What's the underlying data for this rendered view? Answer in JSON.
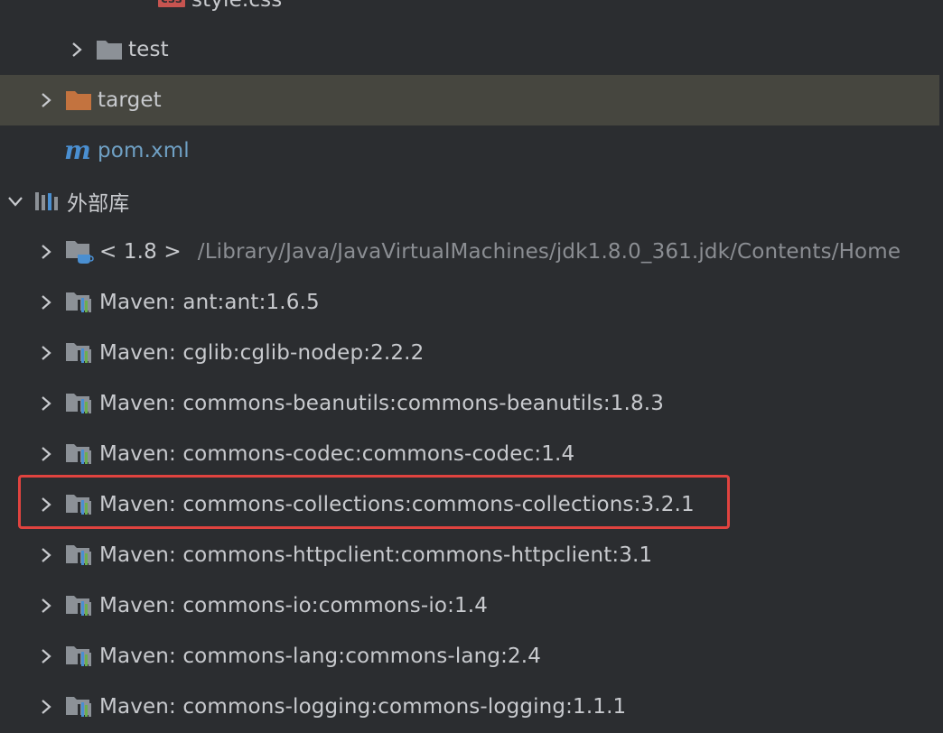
{
  "tree": {
    "style_css": {
      "badge": "css",
      "label": "style.css"
    },
    "test": {
      "label": "test"
    },
    "target": {
      "label": "target"
    },
    "pom": {
      "label": "pom.xml"
    },
    "external_libraries": {
      "label": "外部库"
    },
    "jdk": {
      "label": "< 1.8 >",
      "path": "/Library/Java/JavaVirtualMachines/jdk1.8.0_361.jdk/Contents/Home"
    },
    "libraries": [
      {
        "label": "Maven: ant:ant:1.6.5"
      },
      {
        "label": "Maven: cglib:cglib-nodep:2.2.2"
      },
      {
        "label": "Maven: commons-beanutils:commons-beanutils:1.8.3"
      },
      {
        "label": "Maven: commons-codec:commons-codec:1.4"
      },
      {
        "label": "Maven: commons-collections:commons-collections:3.2.1"
      },
      {
        "label": "Maven: commons-httpclient:commons-httpclient:3.1"
      },
      {
        "label": "Maven: commons-io:commons-io:1.4"
      },
      {
        "label": "Maven: commons-lang:commons-lang:2.4"
      },
      {
        "label": "Maven: commons-logging:commons-logging:1.1.1"
      }
    ]
  },
  "colors": {
    "background": "#2b2d30",
    "selected_row": "#46463f",
    "text": "#c8cace",
    "path_text": "#8b8e93",
    "folder_gray": "#8c9197",
    "folder_orange": "#c3733f",
    "maven_blue": "#4a8fd1",
    "highlight_border": "#e0433f"
  },
  "icons": {
    "chevron_right": "chevron-right-icon",
    "chevron_down": "chevron-down-icon",
    "folder": "folder-icon",
    "excluded_folder": "excluded-folder-icon",
    "maven_file": "maven-file-icon",
    "libraries": "libraries-icon",
    "jdk": "jdk-icon",
    "library": "library-icon"
  }
}
